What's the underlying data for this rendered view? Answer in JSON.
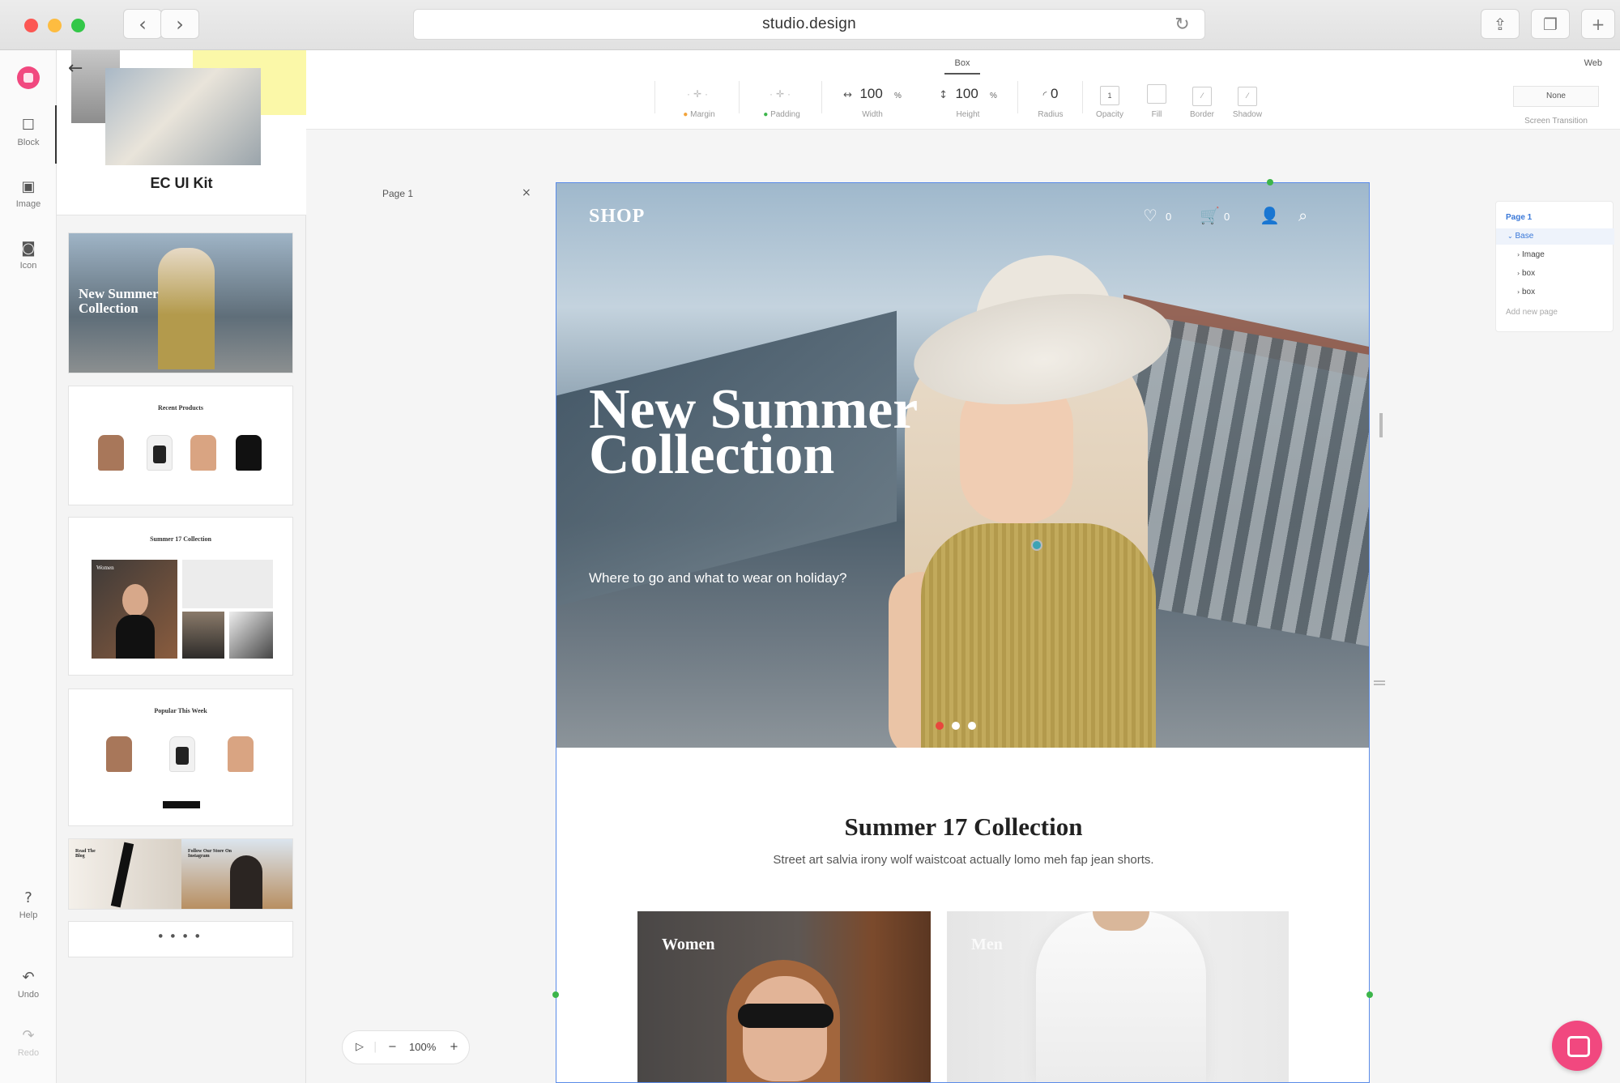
{
  "browser": {
    "url": "studio.design",
    "traffic_lights": {
      "close": "#fc5753",
      "minimize": "#fdbc40",
      "zoom": "#33c748"
    }
  },
  "rail": {
    "tools": [
      {
        "name": "Block",
        "icon": "square-icon"
      },
      {
        "name": "Image",
        "icon": "image-icon"
      },
      {
        "name": "Icon",
        "icon": "icon-icon"
      }
    ],
    "bottom": [
      {
        "name": "Help",
        "icon": "question-icon"
      },
      {
        "name": "Undo",
        "icon": "undo-icon"
      },
      {
        "name": "Redo",
        "icon": "redo-icon"
      }
    ]
  },
  "panel": {
    "kit_title": "EC UI Kit",
    "thumb1_text": "New Summer Collection",
    "thumb2_title": "Recent Products",
    "thumb3_title": "Summer 17 Collection",
    "thumb3_label": "Women",
    "thumb4_title": "Popular This Week",
    "thumb5_left": "Read The Blog",
    "thumb5_right": "Follow Our Store On Instagram"
  },
  "propbar": {
    "active_tab": "Box",
    "right_tab": "Web",
    "margin_label": "Margin",
    "padding_label": "Padding",
    "width_value": "100",
    "width_unit": "%",
    "width_label": "Width",
    "height_value": "100",
    "height_unit": "%",
    "height_label": "Height",
    "radius_value": "0",
    "radius_label": "Radius",
    "opacity_value": "1",
    "opacity_label": "Opacity",
    "fill_label": "Fill",
    "border_label": "Border",
    "shadow_label": "Shadow",
    "transition_value": "None",
    "transition_label": "Screen Transition"
  },
  "canvas": {
    "page_label": "Page 1",
    "zoom": "100%"
  },
  "site": {
    "brand": "SHOP",
    "wishlist_count": "0",
    "cart_count": "0",
    "hero_title": "New Summer Collection",
    "hero_subtitle": "Where to go and what to wear on holiday?",
    "section_title": "Summer 17 Collection",
    "section_subtitle": "Street art salvia irony wolf waistcoat actually lomo meh fap jean shorts.",
    "card_women": "Women",
    "card_men": "Men",
    "slider_active_color": "#e8473d"
  },
  "layers": {
    "page": "Page 1",
    "items": [
      "Base",
      "Image",
      "box",
      "box"
    ],
    "add_page": "Add new page"
  },
  "colors": {
    "accent": "#f1487f",
    "selection": "#5a8be8",
    "layer_active": "#3a78d8"
  }
}
